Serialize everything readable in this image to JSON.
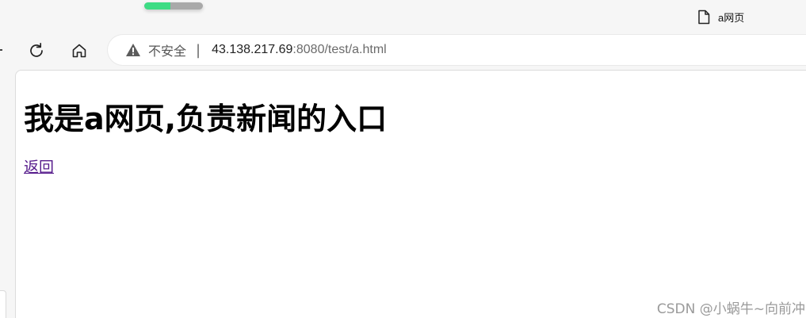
{
  "loading": {
    "progress_fraction": 0.45,
    "fill_color": "#3ddc84",
    "track_color": "#a9a9a9"
  },
  "tab": {
    "title": "a网页",
    "icon": "document-icon"
  },
  "toolbar": {
    "reload_icon": "reload-icon",
    "home_icon": "home-icon"
  },
  "address_bar": {
    "security_icon": "warning-triangle-icon",
    "security_label": "不安全",
    "separator": "|",
    "url_host": "43.138.217.69",
    "url_rest": ":8080/test/a.html"
  },
  "page": {
    "heading": "我是a网页,负责新闻的入口",
    "back_link": "返回"
  },
  "watermark": "CSDN @小蜗牛~向前冲",
  "colors": {
    "link_visited": "#551a8b",
    "chrome_bg": "#f6f6f6"
  }
}
